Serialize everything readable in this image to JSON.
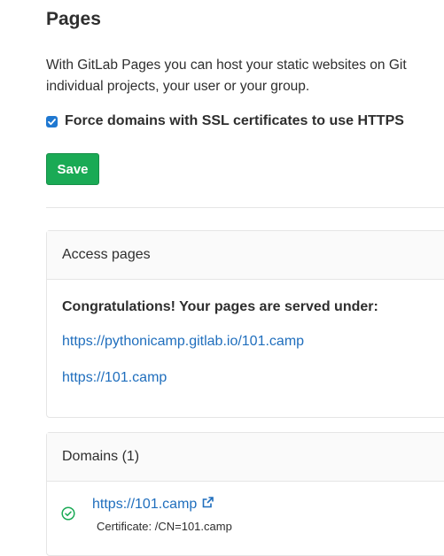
{
  "page": {
    "title": "Pages",
    "description_line1": "With GitLab Pages you can host your static websites on Git",
    "description_line2": "individual projects, your user or your group."
  },
  "settings": {
    "force_https_label": "Force domains with SSL certificates to use HTTPS",
    "force_https_checked": true,
    "save_label": "Save"
  },
  "access_panel": {
    "heading": "Access pages",
    "congrats": "Congratulations! Your pages are served under:",
    "links": [
      "https://pythonicamp.gitlab.io/101.camp",
      "https://101.camp"
    ]
  },
  "domains_panel": {
    "heading": "Domains (1)",
    "domains": [
      {
        "url": "https://101.camp",
        "certificate": "Certificate: /CN=101.camp",
        "status_icon": "check-circle-icon"
      }
    ]
  },
  "colors": {
    "accent_blue": "#1f78d1",
    "link_blue": "#1f6ebd",
    "save_green": "#1aaa55",
    "success_green": "#1aaa55"
  }
}
